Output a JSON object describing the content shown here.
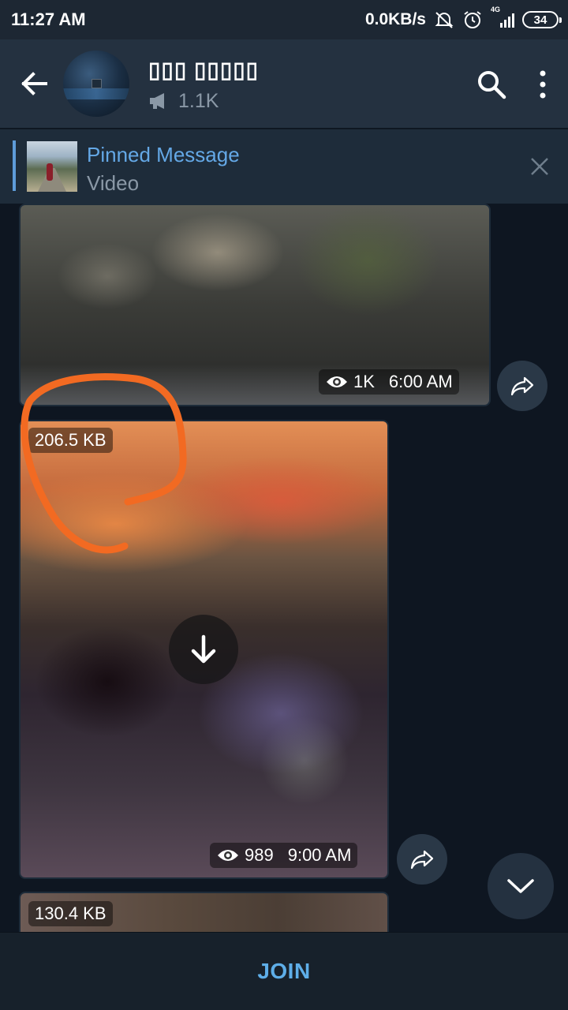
{
  "status_bar": {
    "time": "11:27 AM",
    "speed": "0.0KB/s",
    "network": "4G",
    "battery": "34"
  },
  "header": {
    "channel_name": "▯▯▯ ▯▯▯▯▯",
    "subscribers": "1.1K",
    "icons": [
      "back-arrow-icon",
      "megaphone-icon",
      "search-icon",
      "more-vertical-icon"
    ]
  },
  "pinned": {
    "title": "Pinned Message",
    "subtitle": "Video"
  },
  "messages": [
    {
      "views": "1K",
      "time": "6:00 AM"
    },
    {
      "size": "206.5 KB",
      "views": "989",
      "time": "9:00 AM"
    },
    {
      "size": "130.4 KB"
    }
  ],
  "footer": {
    "join_label": "JOIN"
  },
  "colors": {
    "accent": "#5eaee8",
    "header_bg": "#243140",
    "annotation": "#f26a22"
  }
}
